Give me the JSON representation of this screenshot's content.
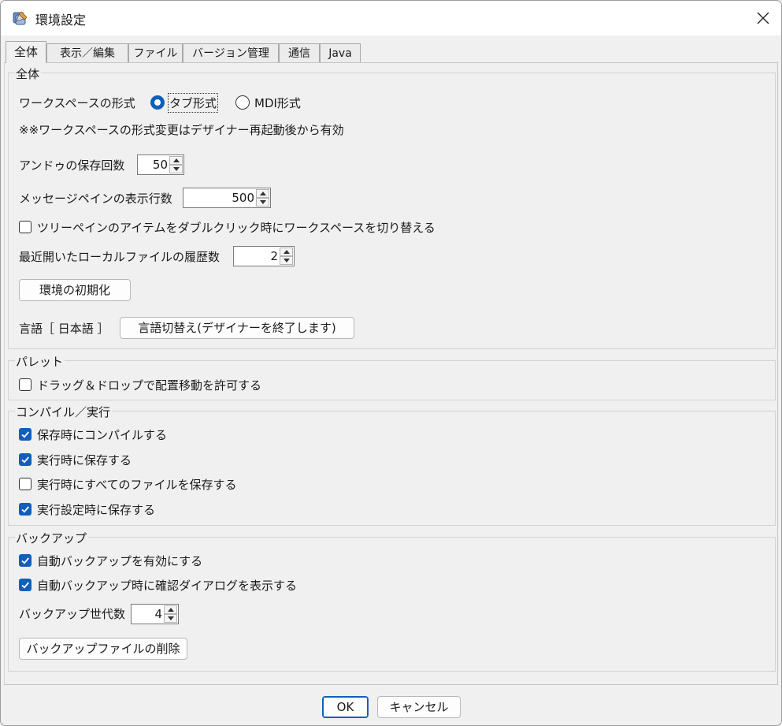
{
  "window": {
    "title": "環境設定",
    "app_icon": "settings-app-icon",
    "close_icon": "close-icon"
  },
  "tabs": [
    {
      "label": "全体",
      "active": true
    },
    {
      "label": "表示／編集",
      "active": false
    },
    {
      "label": "ファイル",
      "active": false
    },
    {
      "label": "バージョン管理",
      "active": false
    },
    {
      "label": "通信",
      "active": false
    },
    {
      "label": "Java",
      "active": false
    }
  ],
  "general": {
    "title": "全体",
    "workspace_label": "ワークスペースの形式",
    "radio_tab": "タブ形式",
    "radio_mdi": "MDI形式",
    "selected": "タブ形式",
    "note": "※※ワークスペースの形式変更はデザイナー再起動後から有効",
    "undo_label": "アンドゥの保存回数",
    "undo_value": "50",
    "message_label": "メッセージペインの表示行数",
    "message_value": "500",
    "tree_switch_label": "ツリーペインのアイテムをダブルクリック時にワークスペースを切り替える",
    "tree_switch_checked": false,
    "recent_label": "最近開いたローカルファイルの履歴数",
    "recent_value": "2",
    "reset_button": "環境の初期化",
    "language_label": "言語［ 日本語 ］",
    "language_button": "言語切替え(デザイナーを終了します)"
  },
  "palette": {
    "title": "パレット",
    "dragdrop_label": "ドラッグ＆ドロップで配置移動を許可する",
    "dragdrop_checked": false
  },
  "compile": {
    "title": "コンパイル／実行",
    "items": [
      {
        "label": "保存時にコンパイルする",
        "checked": true
      },
      {
        "label": "実行時に保存する",
        "checked": true
      },
      {
        "label": "実行時にすべてのファイルを保存する",
        "checked": false
      },
      {
        "label": "実行設定時に保存する",
        "checked": true
      }
    ]
  },
  "backup": {
    "title": "バックアップ",
    "items": [
      {
        "label": "自動バックアップを有効にする",
        "checked": true
      },
      {
        "label": "自動バックアップ時に確認ダイアログを表示する",
        "checked": true
      }
    ],
    "generations_label": "バックアップ世代数",
    "generations_value": "4",
    "delete_button": "バックアップファイルの削除"
  },
  "footer": {
    "ok": "OK",
    "cancel": "キャンセル"
  },
  "colors": {
    "accent": "#0f5fbd",
    "background": "#f0f0f0"
  }
}
